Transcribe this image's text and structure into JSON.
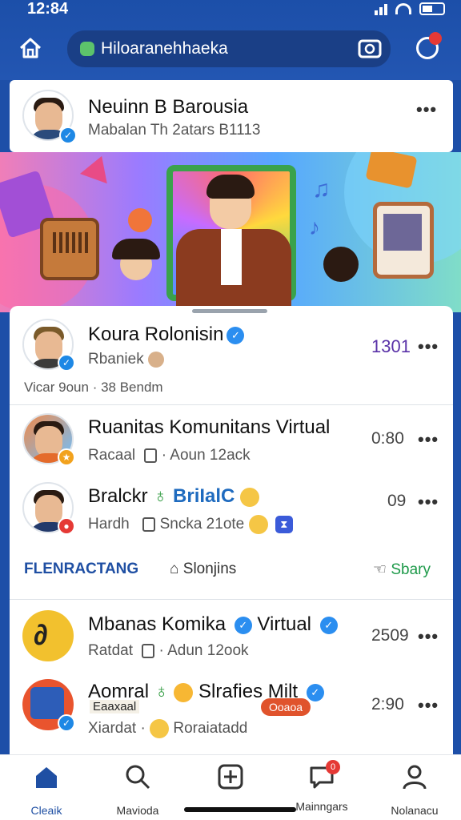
{
  "status_bar": {
    "time": "12:84"
  },
  "header": {
    "search_text": "Hiloaranehhaeka",
    "icons": [
      "home-icon",
      "lock-icon",
      "camera-icon",
      "notification-icon"
    ],
    "accent": "#1c4fa9"
  },
  "profile_card": {
    "name": "Neuinn B Barousia",
    "subtitle": "Mabalan Th 2atars B1113"
  },
  "feed": {
    "first": {
      "name": "Koura Rolonisin",
      "subtitle": "Rbaniek",
      "meta": "Vicar 9oun · 38 Bendm",
      "count": "1301"
    },
    "items": [
      {
        "name": "Ruanitas Komunitans Virtual",
        "sub_left": "Racaal",
        "sub_right": "Aoun 12ack",
        "time": "0:80"
      },
      {
        "name": "Bralckr",
        "name_extra": "BriIalC",
        "sub_left": "Hardh",
        "sub_right": "Sncka 21ote",
        "time": "09"
      },
      {
        "name": "Mbanas Komika",
        "name_extra": "Virtual",
        "sub_left": "Ratdat",
        "sub_right": "Adun 12ook",
        "time": "2509"
      },
      {
        "name": "Aomral",
        "name_extra": "Slrafies Milt",
        "sub_left": "Xiardat",
        "sub_right": "Roraiatadd",
        "time": "2:90"
      }
    ],
    "actions": {
      "left": "FLENRACTANG",
      "mid": "Slonjins",
      "right": "Sbary"
    },
    "overlay_tags": [
      "Eaaxaal",
      "Ooaoa"
    ]
  },
  "tabbar": {
    "tabs": [
      {
        "label": "Cleaik",
        "icon": "home-icon"
      },
      {
        "label": "Mavioda",
        "icon": "search-icon"
      },
      {
        "label": "",
        "icon": "add-icon"
      },
      {
        "label": "Mainngars",
        "icon": "chat-icon",
        "badge": "0"
      },
      {
        "label": "Nolanacu",
        "icon": "profile-icon"
      }
    ]
  },
  "colors": {
    "brand_blue": "#1f4fa3",
    "accent_green": "#1e9a4a",
    "count_purple": "#5a32a8"
  }
}
